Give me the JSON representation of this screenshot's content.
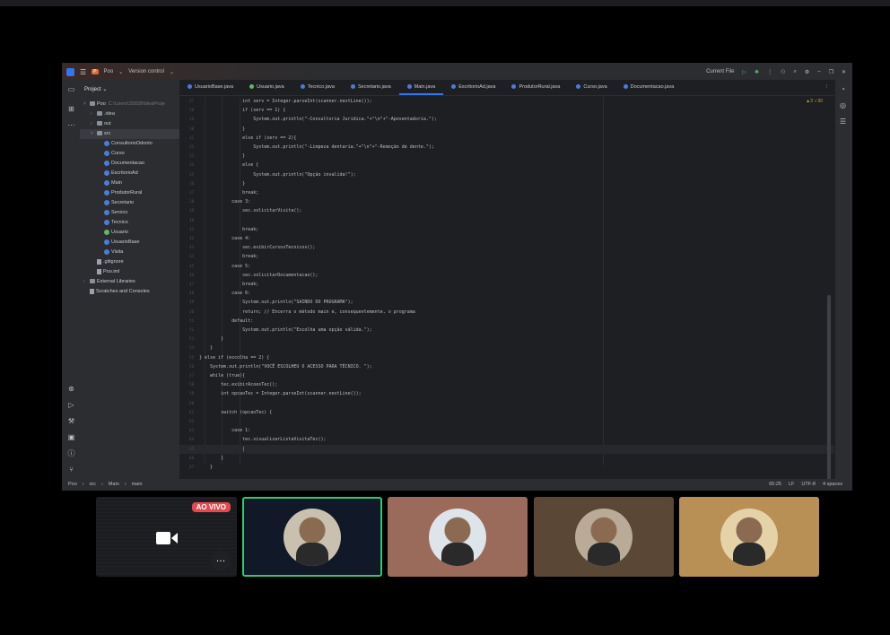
{
  "ide": {
    "project_label": "P",
    "project_name": "Poo",
    "version_control": "Version control",
    "run_config": "Current File",
    "project_panel_title": "Project",
    "tree": [
      {
        "label": "Poo",
        "suffix": "C:\\Users\\35838\\IdeaProje",
        "kind": "folder",
        "indent": 1,
        "chev": "˅"
      },
      {
        "label": ".idea",
        "kind": "folder",
        "indent": 2,
        "chev": "›"
      },
      {
        "label": "out",
        "kind": "folder",
        "indent": 2,
        "chev": "›"
      },
      {
        "label": "src",
        "kind": "folder",
        "indent": 2,
        "chev": "˅",
        "selected": true
      },
      {
        "label": "ConsultorioOdonto",
        "kind": "class",
        "indent": 3
      },
      {
        "label": "Curso",
        "kind": "class",
        "indent": 3
      },
      {
        "label": "Documentacao",
        "kind": "class",
        "indent": 3
      },
      {
        "label": "EscritorioAd",
        "kind": "class",
        "indent": 3
      },
      {
        "label": "Main",
        "kind": "class",
        "indent": 3
      },
      {
        "label": "ProdutorRural",
        "kind": "class",
        "indent": 3
      },
      {
        "label": "Secretario",
        "kind": "class",
        "indent": 3
      },
      {
        "label": "Servico",
        "kind": "class",
        "indent": 3
      },
      {
        "label": "Tecnico",
        "kind": "class",
        "indent": 3
      },
      {
        "label": "Usuario",
        "kind": "int",
        "indent": 3
      },
      {
        "label": "UsuarioBase",
        "kind": "class",
        "indent": 3
      },
      {
        "label": "Visita",
        "kind": "class",
        "indent": 3
      },
      {
        "label": ".gitignore",
        "kind": "file",
        "indent": 2
      },
      {
        "label": "Poo.iml",
        "kind": "file",
        "indent": 2
      },
      {
        "label": "External Libraries",
        "kind": "folder",
        "indent": 1,
        "chev": "›"
      },
      {
        "label": "Scratches and Consoles",
        "kind": "file",
        "indent": 1
      }
    ],
    "tabs": [
      {
        "label": "UsuarioBase.java",
        "icon": "class"
      },
      {
        "label": "Usuario.java",
        "icon": "int"
      },
      {
        "label": "Tecnico.java",
        "icon": "class"
      },
      {
        "label": "Secretario.java",
        "icon": "class"
      },
      {
        "label": "Main.java",
        "icon": "class",
        "active": true
      },
      {
        "label": "EscritorioAd.java",
        "icon": "class"
      },
      {
        "label": "ProdutorRural.java",
        "icon": "class"
      },
      {
        "label": "Curso.java",
        "icon": "class"
      },
      {
        "label": "Documentacao.java",
        "icon": "class"
      }
    ],
    "inspections": "▲3  ✓30",
    "code_lines": [
      {
        "n": "27",
        "t": "                int serv = Integer.parseInt(scanner.nextLine());"
      },
      {
        "n": "28",
        "t": "                if (serv == 1) {"
      },
      {
        "n": "29",
        "t": "                    System.out.println(\"-Consultoria Juridica.\"+\"\\n\"+\"-Aposentadoria.\");"
      },
      {
        "n": "30",
        "t": "                }"
      },
      {
        "n": "31",
        "t": "                else if (serv == 2){"
      },
      {
        "n": "32",
        "t": "                    System.out.println(\"-Limpeza dentaria.\"+\"\\n\"+\"-Remoção de dente.\");"
      },
      {
        "n": "33",
        "t": "                }"
      },
      {
        "n": "34",
        "t": "                else {"
      },
      {
        "n": "35",
        "t": "                    System.out.println(\"Opção invalida!\");"
      },
      {
        "n": "36",
        "t": "                }"
      },
      {
        "n": "37",
        "t": "                break;"
      },
      {
        "n": "38",
        "t": "            case 3:"
      },
      {
        "n": "39",
        "t": "                sec.solicitarVisita();"
      },
      {
        "n": "40",
        "t": ""
      },
      {
        "n": "41",
        "t": "                break;"
      },
      {
        "n": "42",
        "t": "            case 4:"
      },
      {
        "n": "43",
        "t": "                sec.exibirCursosTecnicos();"
      },
      {
        "n": "44",
        "t": "                break;"
      },
      {
        "n": "45",
        "t": "            case 5:"
      },
      {
        "n": "46",
        "t": "                sec.solicitarDocumentacao();"
      },
      {
        "n": "47",
        "t": "                break;"
      },
      {
        "n": "48",
        "t": "            case 6:"
      },
      {
        "n": "49",
        "t": "                System.out.println(\"SAINDO DO PROGRAMA\");"
      },
      {
        "n": "50",
        "t": "                return; // Encerra o método main e, consequentemente, o programa"
      },
      {
        "n": "51",
        "t": "            default:"
      },
      {
        "n": "52",
        "t": "                System.out.println(\"Escolha uma opção válida.\");"
      },
      {
        "n": "53",
        "t": "        }"
      },
      {
        "n": "54",
        "t": "    }"
      },
      {
        "n": "55",
        "t": "} else if (escolha == 2) {"
      },
      {
        "n": "56",
        "t": "    System.out.println(\"VOCÊ ESCOLHEU O ACESSO PARA TÉCNICO. \");"
      },
      {
        "n": "57",
        "t": "    while (true){"
      },
      {
        "n": "58",
        "t": "        tec.exibirAcoesTec();"
      },
      {
        "n": "59",
        "t": "        int opcaoTec = Integer.parseInt(scanner.nextLine());"
      },
      {
        "n": "60",
        "t": ""
      },
      {
        "n": "61",
        "t": "        switch (opcaoTec) {"
      },
      {
        "n": "62",
        "t": ""
      },
      {
        "n": "63",
        "t": "            case 1:"
      },
      {
        "n": "64",
        "t": "                tec.visualizarListaVisitaTec();"
      },
      {
        "n": "65",
        "t": "                |",
        "current": true
      },
      {
        "n": "66",
        "t": "        }"
      },
      {
        "n": "67",
        "t": "    }"
      }
    ],
    "status": {
      "crumbs": [
        "Poo",
        "src",
        "Main",
        "main"
      ],
      "position": "65:25",
      "line_sep": "LF",
      "encoding": "UTF-8",
      "indent": "4 spaces"
    }
  },
  "meeting": {
    "live_label": "AO VIVO",
    "tiles": [
      {
        "bg": "#111827",
        "face": "#c9c0b0",
        "speaking": true
      },
      {
        "bg": "#9a6a5a",
        "face": "#dde4ea"
      },
      {
        "bg": "#5a4736",
        "face": "#b9ab98"
      },
      {
        "bg": "#b88f55",
        "face": "#e6d2a8"
      }
    ]
  }
}
